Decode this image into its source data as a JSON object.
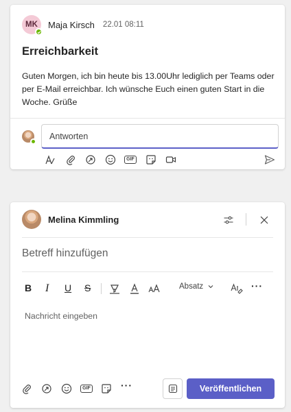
{
  "post": {
    "author_initials": "MK",
    "author_name": "Maja Kirsch",
    "timestamp": "22.01 08:11",
    "subject": "Erreichbarkeit",
    "body": "Guten Morgen, ich bin heute bis 13.00Uhr lediglich per Teams oder per E-Mail erreichbar. Ich wünsche Euch einen guten Start in die Woche. Grüße",
    "reply_placeholder": "Antworten",
    "presence_color": "#6bb700"
  },
  "reply_toolbar": {
    "gif_label": "GIF",
    "icons": [
      "format-icon",
      "attach-icon",
      "loop-icon",
      "emoji-icon",
      "gif-icon",
      "sticker-icon",
      "video-icon",
      "send-icon"
    ]
  },
  "compose": {
    "author_name": "Melina Kimmling",
    "subject_placeholder": "Betreff hinzufügen",
    "format_bold": "B",
    "format_italic": "I",
    "format_underline": "U",
    "format_strike": "S",
    "paragraph_label": "Absatz",
    "more_label": "···",
    "message_placeholder": "Nachricht eingeben",
    "gif_label": "GIF",
    "publish_label": "Veröffentlichen",
    "accent_color": "#5b5fc7"
  }
}
